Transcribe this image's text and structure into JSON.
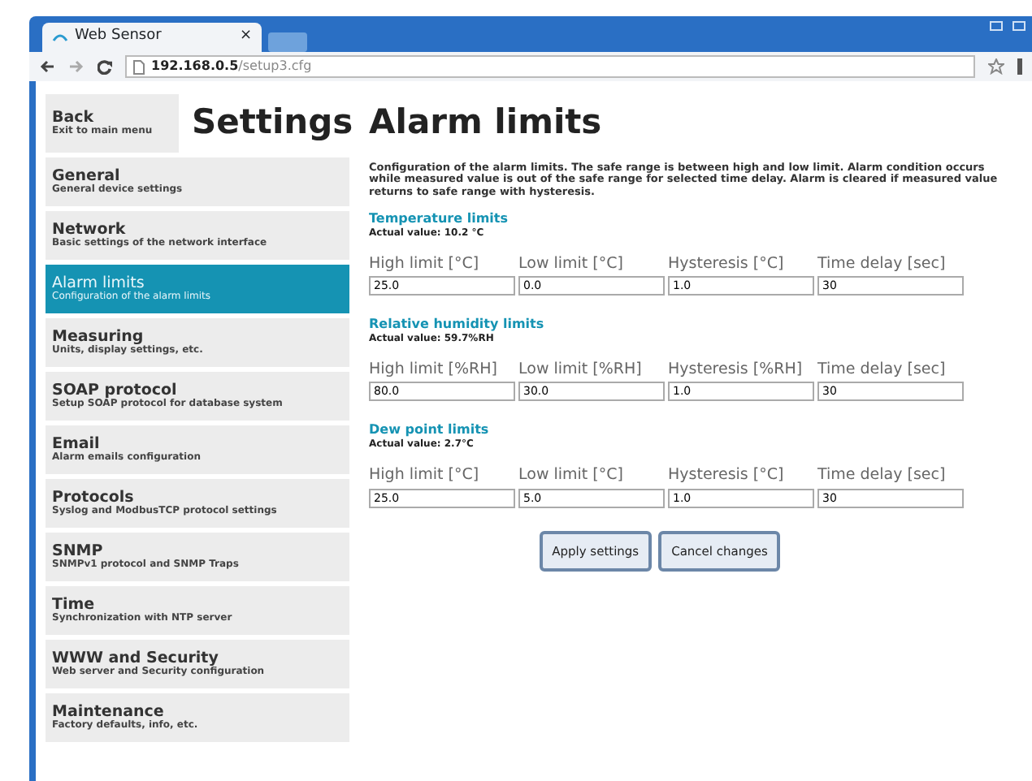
{
  "browser": {
    "tab_title": "Web Sensor",
    "tab_close": "×",
    "url_host": "192.168.0.5",
    "url_path": "/setup3.cfg"
  },
  "sidebar": {
    "back": {
      "title": "Back",
      "subtitle": "Exit to main menu"
    },
    "heading": "Settings",
    "items": [
      {
        "title": "General",
        "subtitle": "General device settings",
        "selected": false
      },
      {
        "title": "Network",
        "subtitle": "Basic settings of the network interface",
        "selected": false
      },
      {
        "title": "Alarm limits",
        "subtitle": "Configuration of the alarm limits",
        "selected": true
      },
      {
        "title": "Measuring",
        "subtitle": "Units, display settings, etc.",
        "selected": false
      },
      {
        "title": "SOAP protocol",
        "subtitle": "Setup SOAP protocol for database system",
        "selected": false
      },
      {
        "title": "Email",
        "subtitle": "Alarm emails configuration",
        "selected": false
      },
      {
        "title": "Protocols",
        "subtitle": "Syslog and ModbusTCP protocol settings",
        "selected": false
      },
      {
        "title": "SNMP",
        "subtitle": "SNMPv1 protocol and SNMP Traps",
        "selected": false
      },
      {
        "title": "Time",
        "subtitle": "Synchronization with NTP server",
        "selected": false
      },
      {
        "title": "WWW and Security",
        "subtitle": "Web server and Security configuration",
        "selected": false
      },
      {
        "title": "Maintenance",
        "subtitle": "Factory defaults, info, etc.",
        "selected": false
      }
    ]
  },
  "main": {
    "title": "Alarm limits",
    "description": "Configuration of the alarm limits. The safe range is between high and low limit. Alarm condition occurs while measured value is out of the safe range for selected time delay. Alarm is cleared if measured value returns to safe range with hysteresis.",
    "sections": [
      {
        "title": "Temperature limits",
        "actual": "Actual value: 10.2 °C",
        "fields": [
          {
            "label": "High limit [°C]",
            "value": "25.0"
          },
          {
            "label": "Low limit [°C]",
            "value": "0.0"
          },
          {
            "label": "Hysteresis [°C]",
            "value": "1.0"
          },
          {
            "label": "Time delay [sec]",
            "value": "30"
          }
        ]
      },
      {
        "title": "Relative humidity limits",
        "actual": "Actual value: 59.7%RH",
        "fields": [
          {
            "label": "High limit [%RH]",
            "value": "80.0"
          },
          {
            "label": "Low limit [%RH]",
            "value": "30.0"
          },
          {
            "label": "Hysteresis [%RH]",
            "value": "1.0"
          },
          {
            "label": "Time delay [sec]",
            "value": "30"
          }
        ]
      },
      {
        "title": "Dew point limits",
        "actual": "Actual value: 2.7°C",
        "fields": [
          {
            "label": "High limit [°C]",
            "value": "25.0"
          },
          {
            "label": "Low limit [°C]",
            "value": "5.0"
          },
          {
            "label": "Hysteresis [°C]",
            "value": "1.0"
          },
          {
            "label": "Time delay [sec]",
            "value": "30"
          }
        ]
      }
    ],
    "buttons": [
      "Apply settings",
      "Cancel changes"
    ]
  }
}
